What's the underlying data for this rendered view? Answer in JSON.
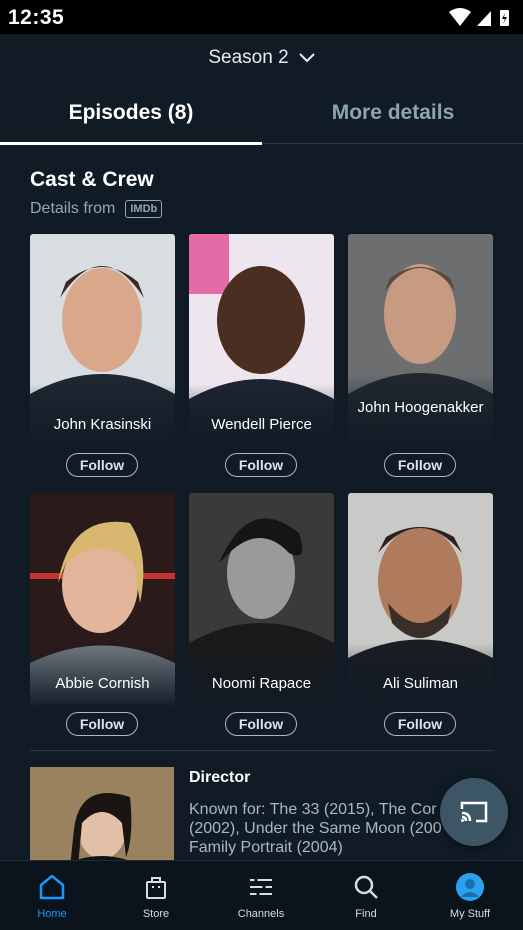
{
  "status_bar": {
    "time": "12:35"
  },
  "header": {
    "season_label": "Season 2",
    "tabs": [
      {
        "label": "Episodes (8)",
        "active": true
      },
      {
        "label": "More details",
        "active": false
      }
    ]
  },
  "cast": {
    "title": "Cast & Crew",
    "details_from": "Details from",
    "source_badge": "IMDb",
    "follow_label": "Follow",
    "members": [
      {
        "name": "John Krasinski"
      },
      {
        "name": "Wendell Pierce"
      },
      {
        "name": "John Hoogenakker"
      },
      {
        "name": "Abbie Cornish"
      },
      {
        "name": "Noomi Rapace"
      },
      {
        "name": "Ali Suliman"
      }
    ]
  },
  "director": {
    "role": "Director",
    "known_for": "Known for: The 33 (2015), The Cor (2002), Under the Same Moon (200 Family Portrait (2004)"
  },
  "bottom_nav": {
    "items": [
      {
        "label": "Home",
        "icon": "home-icon",
        "active": true
      },
      {
        "label": "Store",
        "icon": "bag-icon",
        "active": false
      },
      {
        "label": "Channels",
        "icon": "channels-icon",
        "active": false
      },
      {
        "label": "Find",
        "icon": "search-icon",
        "active": false
      },
      {
        "label": "My Stuff",
        "icon": "avatar",
        "active": false
      }
    ]
  },
  "colors": {
    "accent": "#1a98ff",
    "background": "#101b25"
  }
}
